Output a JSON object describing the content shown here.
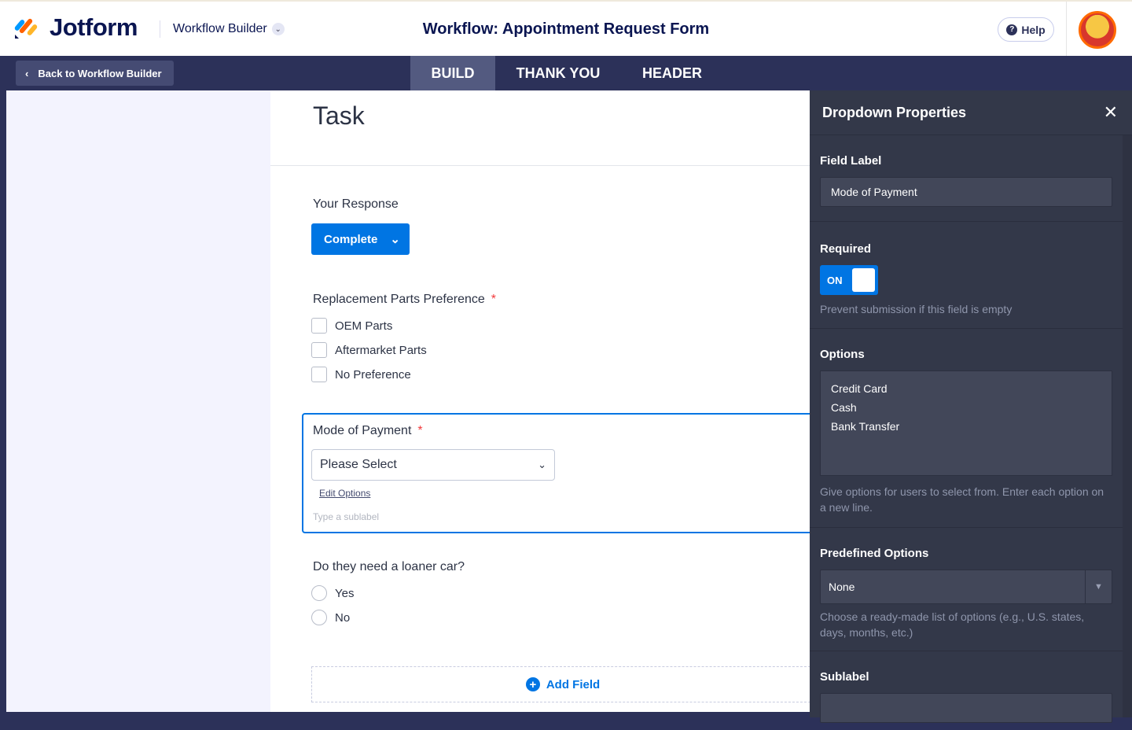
{
  "header": {
    "brand": "Jotform",
    "product": "Workflow Builder",
    "title": "Workflow: Appointment Request Form",
    "help": "Help"
  },
  "nav": {
    "back": "Back to Workflow Builder",
    "tabs": [
      "BUILD",
      "THANK YOU",
      "HEADER"
    ],
    "active_tab": "BUILD"
  },
  "form": {
    "heading": "Task",
    "response_label": "Your Response",
    "response_value": "Complete",
    "parts_label": "Replacement Parts Preference",
    "parts_options": [
      "OEM Parts",
      "Aftermarket Parts",
      "No Preference"
    ],
    "payment_label": "Mode of Payment",
    "payment_placeholder": "Please Select",
    "edit_options": "Edit Options",
    "sublabel_placeholder": "Type a sublabel",
    "loaner_label": "Do they need a loaner car?",
    "loaner_options": [
      "Yes",
      "No"
    ],
    "required_mark": "*",
    "add_field": "Add Field"
  },
  "panel": {
    "title": "Dropdown Properties",
    "field_label_title": "Field Label",
    "field_label_value": "Mode of Payment",
    "required_title": "Required",
    "required_toggle": "ON",
    "required_hint": "Prevent submission if this field is empty",
    "options_title": "Options",
    "options": [
      "Credit Card",
      "Cash",
      "Bank Transfer"
    ],
    "options_hint": "Give options for users to select from. Enter each option on a new line.",
    "predefined_title": "Predefined Options",
    "predefined_value": "None",
    "predefined_hint": "Choose a ready-made list of options (e.g., U.S. states, days, months, etc.)",
    "sublabel_title": "Sublabel"
  },
  "colors": {
    "accent": "#0075e3",
    "navy": "#2c3159",
    "panel": "#333849"
  }
}
